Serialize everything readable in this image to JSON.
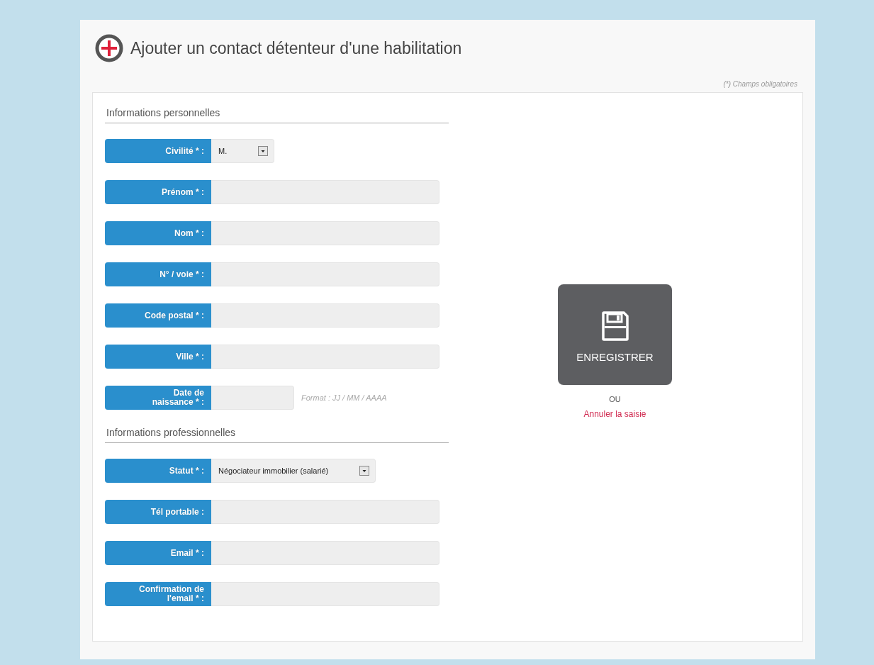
{
  "header": {
    "title": "Ajouter un contact détenteur d'une habilitation",
    "required_note": "(*) Champs obligatoires"
  },
  "sections": [
    {
      "title": "Informations personnelles",
      "fields": [
        {
          "kind": "select",
          "label": "Civilité * :",
          "value": "M."
        },
        {
          "kind": "text",
          "label": "Prénom * :"
        },
        {
          "kind": "text",
          "label": "Nom * :"
        },
        {
          "kind": "text",
          "label": "N° / voie * :"
        },
        {
          "kind": "text",
          "label": "Code postal * :"
        },
        {
          "kind": "text",
          "label": "Ville * :"
        },
        {
          "kind": "date",
          "label": "Date de\nnaissance * :",
          "hint": "Format : JJ / MM / AAAA"
        }
      ]
    },
    {
      "title": "Informations professionnelles",
      "fields": [
        {
          "kind": "select",
          "label": "Statut * :",
          "value": "Négociateur immobilier (salarié)"
        },
        {
          "kind": "text",
          "label": "Tél portable :"
        },
        {
          "kind": "text",
          "label": "Email * :"
        },
        {
          "kind": "text",
          "label": "Confirmation de\nl'email * :"
        }
      ]
    }
  ],
  "actions": {
    "save": "ENREGISTRER",
    "separator": "OU",
    "cancel": "Annuler la saisie"
  }
}
